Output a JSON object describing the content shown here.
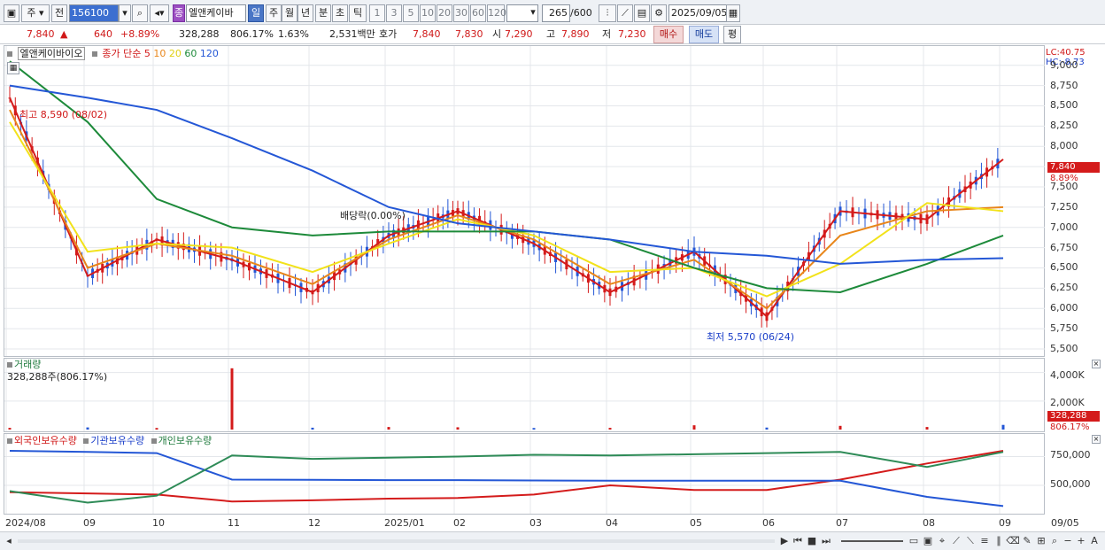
{
  "toolbar": {
    "period_type": "주",
    "prev_label": "전",
    "code": "156100",
    "stock_name": "엘앤케이바",
    "stock_badge": "종",
    "periods": [
      "일",
      "주",
      "월",
      "년",
      "분",
      "초",
      "틱"
    ],
    "active_period": "일",
    "intervals": [
      "1",
      "3",
      "5",
      "10",
      "20",
      "30",
      "60",
      "120"
    ],
    "count": "265",
    "count_total": "/600",
    "date": "2025/09/05"
  },
  "quote": {
    "price": "7,840",
    "change_arrow": "▲",
    "change": "640",
    "change_pct": "+8.89%",
    "volume": "328,288",
    "volume_pct": "806.17%",
    "turnover": "1.63%",
    "amount": "2,531백만",
    "bid_label": "호가",
    "ask": "7,840",
    "bid": "7,830",
    "open_label": "시",
    "open": "7,290",
    "high_label": "고",
    "high": "7,890",
    "low_label": "저",
    "low": "7,230",
    "buy_label": "매수",
    "sell_label": "매도",
    "avg_label": "평"
  },
  "price_panel": {
    "name": "엘앤케이바이오",
    "ma_label": "종가 단순",
    "ma_periods": [
      "5",
      "10",
      "20",
      "60",
      "120"
    ],
    "ma_colors": [
      "#d41b1b",
      "#e8861a",
      "#f2e21a",
      "#1d8a3a",
      "#2457d6"
    ],
    "lc": "LC:40.75",
    "hc": "HC:-8.73",
    "y_ticks": [
      "9,000",
      "8,750",
      "8,500",
      "8,250",
      "8,000",
      "7,750",
      "7,500",
      "7,250",
      "7,000",
      "6,750",
      "6,500",
      "6,250",
      "6,000",
      "5,750",
      "5,500"
    ],
    "last_price": "7,840",
    "last_pct": "8.89%",
    "high_note": "최고 8,590 (08/02)",
    "low_note": "최저 5,570 (06/24)",
    "dividend_note": "배당락(0.00%)"
  },
  "volume_panel": {
    "title": "거래량",
    "value_note": "328,288주(806.17%)",
    "y_ticks": [
      "4,000K",
      "2,000K"
    ],
    "last_volume": "328,288",
    "last_pct": "806.17%"
  },
  "holding_panel": {
    "series": [
      "외국인보유수량",
      "기관보유수량",
      "개인보유수량"
    ],
    "series_colors": [
      "#d41b1b",
      "#2457d6",
      "#2e8b57"
    ],
    "y_ticks": [
      "750,000",
      "500,000"
    ]
  },
  "x_labels": [
    "2024/08",
    "09",
    "10",
    "11",
    "12",
    "2025/01",
    "02",
    "03",
    "04",
    "05",
    "06",
    "07",
    "08",
    "09",
    "09/05"
  ],
  "chart_data": [
    {
      "type": "line",
      "title": "엘앤케이바이오 종가 단순",
      "ylim": [
        5500,
        9150
      ],
      "x": [
        "2024/08",
        "09",
        "10",
        "11",
        "12",
        "2025/01",
        "02",
        "03",
        "04",
        "05",
        "06",
        "07",
        "08",
        "09"
      ],
      "series": [
        {
          "name": "5",
          "values": [
            8600,
            6400,
            6850,
            6600,
            6200,
            6900,
            7200,
            6800,
            6200,
            6700,
            5900,
            7200,
            7100,
            7840
          ]
        },
        {
          "name": "10",
          "values": [
            8450,
            6500,
            6800,
            6650,
            6300,
            6850,
            7150,
            6850,
            6300,
            6600,
            6000,
            6900,
            7200,
            7250
          ]
        },
        {
          "name": "20",
          "values": [
            8300,
            6700,
            6800,
            6750,
            6450,
            6800,
            7100,
            6900,
            6450,
            6500,
            6150,
            6550,
            7300,
            7200
          ]
        },
        {
          "name": "60",
          "values": [
            9050,
            8300,
            7350,
            7000,
            6900,
            6950,
            6950,
            6950,
            6850,
            6500,
            6250,
            6200,
            6550,
            6900
          ]
        },
        {
          "name": "120",
          "values": [
            8750,
            8600,
            8450,
            8100,
            7700,
            7250,
            7050,
            6950,
            6850,
            6700,
            6650,
            6550,
            6600,
            6620
          ]
        }
      ]
    },
    {
      "type": "bar",
      "title": "거래량",
      "ylim": [
        0,
        4600
      ],
      "x": [
        "2024/08",
        "09",
        "10",
        "11",
        "12",
        "2025/01",
        "02",
        "03",
        "04",
        "05",
        "06",
        "07",
        "08",
        "09"
      ],
      "values": [
        120,
        150,
        110,
        4300,
        130,
        180,
        160,
        110,
        120,
        300,
        140,
        260,
        180,
        328
      ]
    },
    {
      "type": "line",
      "title": "보유수량",
      "ylim": [
        300000,
        900000
      ],
      "x": [
        "2024/08",
        "09",
        "10",
        "11",
        "12",
        "2025/01",
        "02",
        "03",
        "04",
        "05",
        "06",
        "07",
        "08",
        "09"
      ],
      "series": [
        {
          "name": "외국인보유수량",
          "values": [
            440000,
            430000,
            420000,
            360000,
            370000,
            385000,
            390000,
            420000,
            500000,
            460000,
            460000,
            550000,
            690000,
            800000
          ]
        },
        {
          "name": "기관보유수량",
          "values": [
            800000,
            790000,
            780000,
            550000,
            548000,
            545000,
            545000,
            542000,
            540000,
            540000,
            540000,
            540000,
            400000,
            320000
          ]
        },
        {
          "name": "개인보유수량",
          "values": [
            450000,
            350000,
            410000,
            760000,
            730000,
            740000,
            750000,
            765000,
            760000,
            770000,
            780000,
            790000,
            660000,
            790000
          ]
        }
      ]
    }
  ]
}
